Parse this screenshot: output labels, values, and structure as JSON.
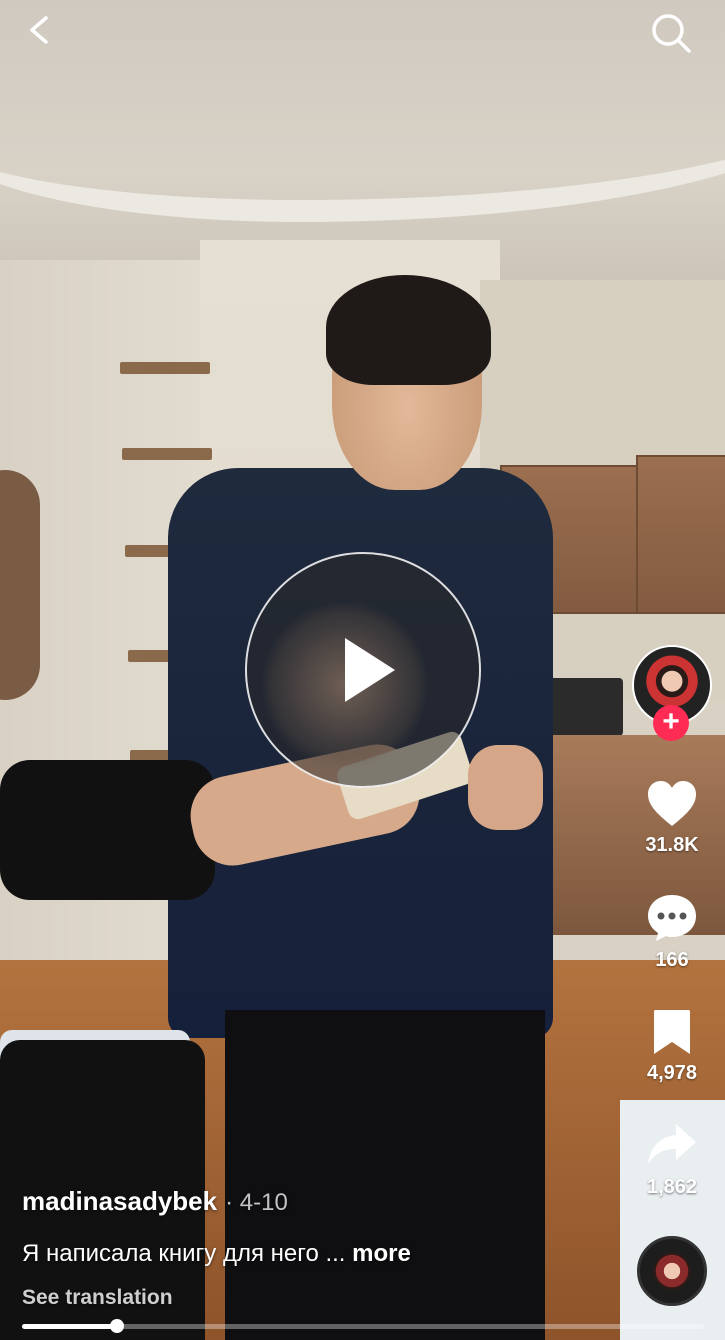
{
  "video": {
    "author": "madinasadybek",
    "date": "· 4-10",
    "caption": "Я написала книгу для него ...",
    "more_label": "more",
    "see_translation": "See translation",
    "progress": 0.14
  },
  "actions": {
    "likes": "31.8K",
    "comments": "166",
    "saves": "4,978",
    "shares": "1,862"
  },
  "icons": {
    "back": "chevron-left-icon",
    "search": "search-icon",
    "play": "play-icon",
    "like": "heart-icon",
    "comment": "comment-icon",
    "save": "bookmark-icon",
    "share": "share-icon",
    "follow": "plus-icon"
  },
  "colors": {
    "accent": "#fe2c55",
    "text": "#ffffff"
  }
}
